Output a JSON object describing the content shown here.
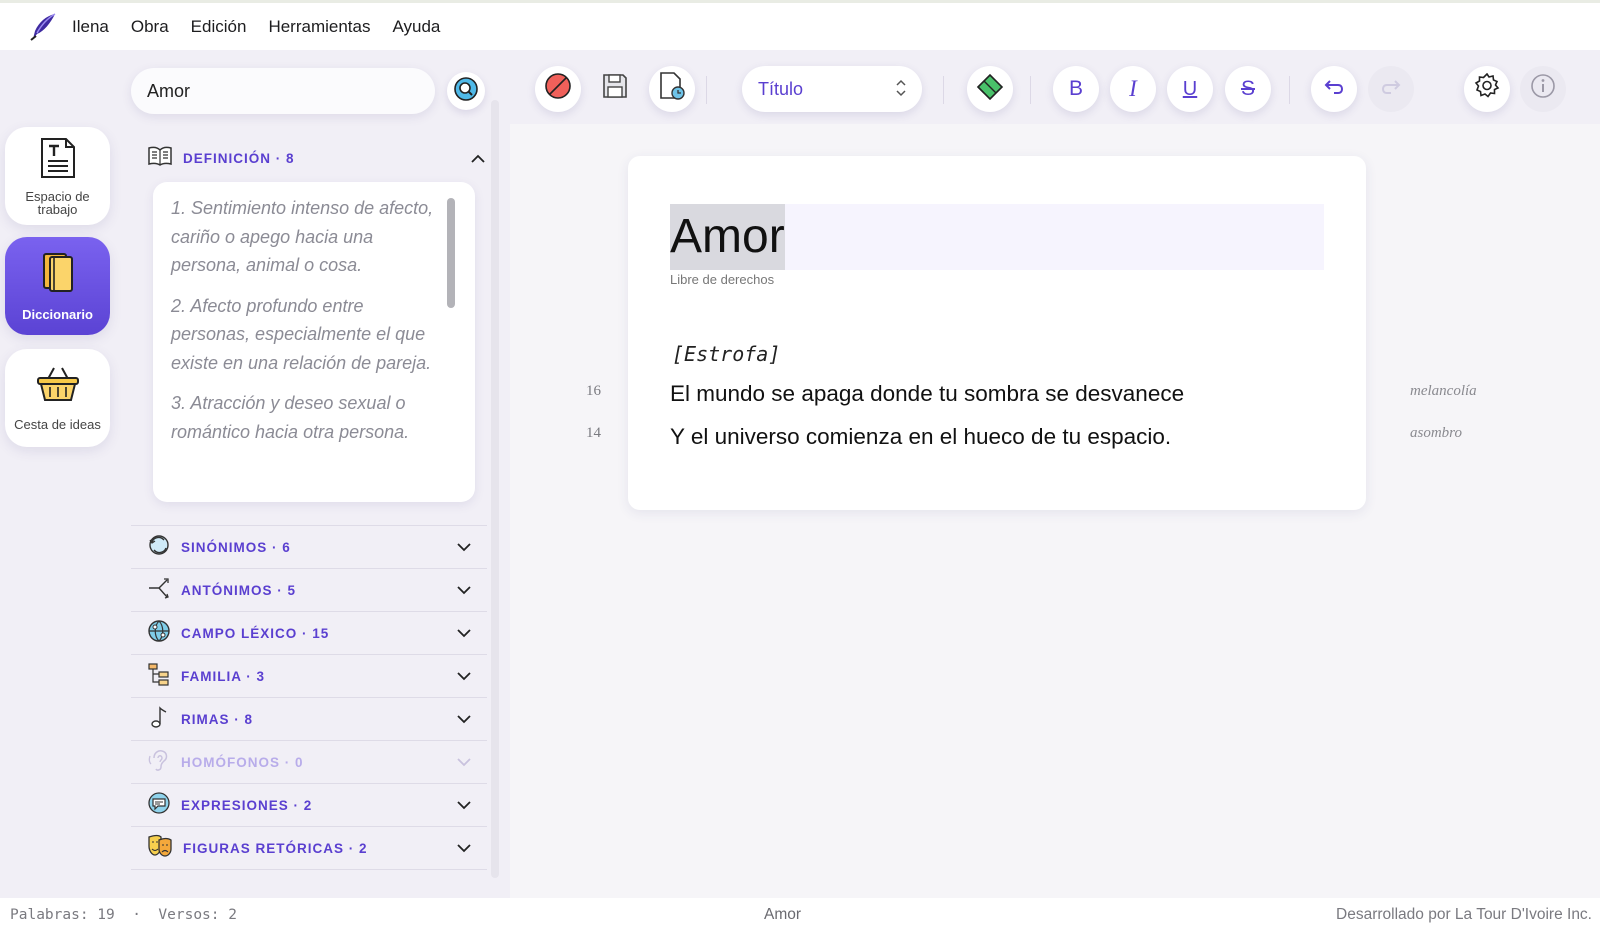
{
  "menu": {
    "items": [
      "Ilena",
      "Obra",
      "Edición",
      "Herramientas",
      "Ayuda"
    ]
  },
  "rail": {
    "workspace": "Espacio de trabajo",
    "dictionary": "Diccionario",
    "basket": "Cesta de ideas"
  },
  "search": {
    "value": "Amor"
  },
  "definition": {
    "title": "DEFINICIÓN · 8",
    "items": [
      "1. Sentimiento intenso de afecto, cariño o apego hacia una persona, animal o cosa.",
      "2. Afecto profundo entre personas, especialmente el que existe en una relación de pareja.",
      "3. Atracción y deseo sexual o romántico hacia otra persona."
    ]
  },
  "sections": [
    {
      "label": "SINÓNIMOS · 6",
      "icon": "synonyms-icon",
      "enabled": true
    },
    {
      "label": "ANTÓNIMOS · 5",
      "icon": "antonyms-icon",
      "enabled": true
    },
    {
      "label": "CAMPO LÉXICO · 15",
      "icon": "globe-icon",
      "enabled": true
    },
    {
      "label": "FAMILIA · 3",
      "icon": "family-tree-icon",
      "enabled": true
    },
    {
      "label": "RIMAS · 8",
      "icon": "music-note-icon",
      "enabled": true
    },
    {
      "label": "HOMÓFONOS · 0",
      "icon": "ear-icon",
      "enabled": false
    },
    {
      "label": "EXPRESIONES · 2",
      "icon": "speech-bubble-icon",
      "enabled": true
    },
    {
      "label": "FIGURAS RETÓRICAS · 2",
      "icon": "theater-masks-icon",
      "enabled": true
    }
  ],
  "toolbar": {
    "style_value": "Título",
    "bold": "B",
    "italic": "I",
    "underline": "U",
    "strike": "S"
  },
  "editor": {
    "title": "Amor",
    "license": "Libre de derechos",
    "stanza_label": "[Estrofa]",
    "verses": [
      {
        "syllables": "16",
        "text": "El mundo se apaga donde tu sombra se desvanece",
        "mood": "melancolía"
      },
      {
        "syllables": "14",
        "text": "Y el universo comienza en el hueco de tu espacio.",
        "mood": "asombro"
      }
    ]
  },
  "status": {
    "left": "Palabras: 19  ·  Versos: 2",
    "center": "Amor",
    "right": "Desarrollado por La Tour D'Ivoire Inc."
  },
  "colors": {
    "accent": "#5a3fd0",
    "accent_disabled": "#b8acea",
    "background": "#f1eff6"
  }
}
